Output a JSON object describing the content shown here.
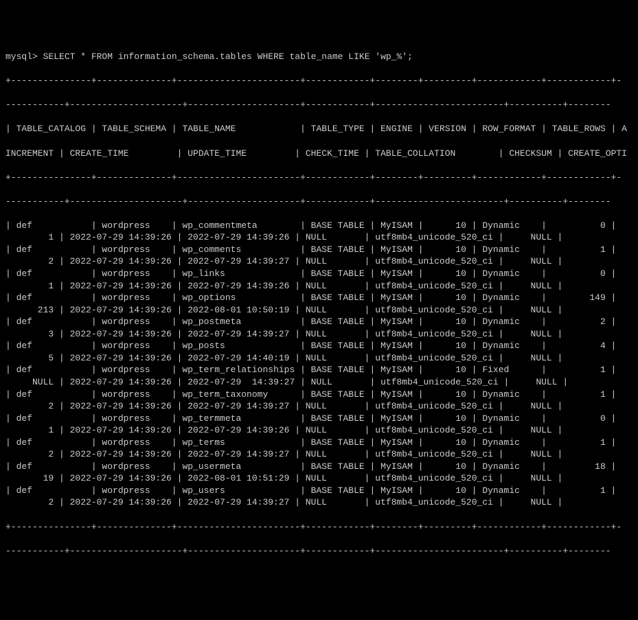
{
  "prompt": "mysql> ",
  "query": "SELECT * FROM information_schema.tables WHERE table_name LIKE 'wp_%';",
  "sep_outer_left": "+---------------+--------------+-----------------------+------------+--------+---------+------------+------------+-",
  "sep_outer_right": "-----------+---------------------+---------------------+------------+------------------------+----------+--------",
  "sep_inner_left": "+---------------+--------------+-----------------------+------------+--------+---------+------------+------------+-",
  "sep_inner_right": "-----------+---------------------+---------------------+------------+------------------------+----------+--------",
  "hdr_line1": "| TABLE_CATALOG | TABLE_SCHEMA | TABLE_NAME            | TABLE_TYPE | ENGINE | VERSION | ROW_FORMAT | TABLE_ROWS | A",
  "hdr_line2": "INCREMENT | CREATE_TIME         | UPDATE_TIME         | CHECK_TIME | TABLE_COLLATION        | CHECKSUM | CREATE_OPTI",
  "rows": [
    {
      "a": "| def           | wordpress    | wp_commentmeta        | BASE TABLE | MyISAM |      10 | Dynamic    |          0 |",
      "b": "        1 | 2022-07-29 14:39:26 | 2022-07-29 14:39:26 | NULL       | utf8mb4_unicode_520_ci |     NULL |"
    },
    {
      "a": "| def           | wordpress    | wp_comments           | BASE TABLE | MyISAM |      10 | Dynamic    |          1 |",
      "b": "        2 | 2022-07-29 14:39:26 | 2022-07-29 14:39:27 | NULL       | utf8mb4_unicode_520_ci |     NULL |"
    },
    {
      "a": "| def           | wordpress    | wp_links              | BASE TABLE | MyISAM |      10 | Dynamic    |          0 |",
      "b": "        1 | 2022-07-29 14:39:26 | 2022-07-29 14:39:26 | NULL       | utf8mb4_unicode_520_ci |     NULL |"
    },
    {
      "a": "| def           | wordpress    | wp_options            | BASE TABLE | MyISAM |      10 | Dynamic    |        149 |",
      "b": "      213 | 2022-07-29 14:39:26 | 2022-08-01 10:50:19 | NULL       | utf8mb4_unicode_520_ci |     NULL |"
    },
    {
      "a": "| def           | wordpress    | wp_postmeta           | BASE TABLE | MyISAM |      10 | Dynamic    |          2 |",
      "b": "        3 | 2022-07-29 14:39:26 | 2022-07-29 14:39:27 | NULL       | utf8mb4_unicode_520_ci |     NULL |"
    },
    {
      "a": "| def           | wordpress    | wp_posts              | BASE TABLE | MyISAM |      10 | Dynamic    |          4 |",
      "b": "        5 | 2022-07-29 14:39:26 | 2022-07-29 14:40:19 | NULL       | utf8mb4_unicode_520_ci |     NULL |"
    },
    {
      "a": "| def           | wordpress    | wp_term_relationships | BASE TABLE | MyISAM |      10 | Fixed      |          1 |",
      "b": "     NULL | 2022-07-29 14:39:26 | 2022-07-29  14:39:27 | NULL       | utf8mb4_unicode_520_ci |     NULL |"
    },
    {
      "a": "| def           | wordpress    | wp_term_taxonomy      | BASE TABLE | MyISAM |      10 | Dynamic    |          1 |",
      "b": "        2 | 2022-07-29 14:39:26 | 2022-07-29 14:39:27 | NULL       | utf8mb4_unicode_520_ci |     NULL |"
    },
    {
      "a": "| def           | wordpress    | wp_termmeta           | BASE TABLE | MyISAM |      10 | Dynamic    |          0 |",
      "b": "        1 | 2022-07-29 14:39:26 | 2022-07-29 14:39:26 | NULL       | utf8mb4_unicode_520_ci |     NULL |"
    },
    {
      "a": "| def           | wordpress    | wp_terms              | BASE TABLE | MyISAM |      10 | Dynamic    |          1 |",
      "b": "        2 | 2022-07-29 14:39:26 | 2022-07-29 14:39:27 | NULL       | utf8mb4_unicode_520_ci |     NULL |"
    },
    {
      "a": "| def           | wordpress    | wp_usermeta           | BASE TABLE | MyISAM |      10 | Dynamic    |         18 |",
      "b": "       19 | 2022-07-29 14:39:26 | 2022-08-01 10:51:29 | NULL       | utf8mb4_unicode_520_ci |     NULL |"
    },
    {
      "a": "| def           | wordpress    | wp_users              | BASE TABLE | MyISAM |      10 | Dynamic    |          1 |",
      "b": "        2 | 2022-07-29 14:39:26 | 2022-07-29 14:39:27 | NULL       | utf8mb4_unicode_520_ci |     NULL |"
    }
  ]
}
